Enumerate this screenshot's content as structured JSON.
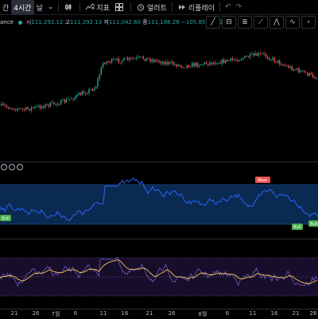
{
  "toolbar": {
    "items": [
      {
        "label": "간",
        "active": false
      },
      {
        "label": "4시간",
        "active": true
      },
      {
        "label": "날",
        "active": false
      }
    ],
    "indicators_label": "지표",
    "alert_label": "얼러트",
    "replay_label": "리플레이"
  },
  "symbol": {
    "name": "ance",
    "ohlc": {
      "open_label": "시",
      "open": "111,292.12",
      "high_label": "고",
      "high": "111,292.13",
      "low_label": "저",
      "low": "111,042.60",
      "close_label": "종",
      "close": "111,186.28",
      "change": "−105.85 (−0.10%)"
    }
  },
  "colors": {
    "up": "#26a69a",
    "down": "#ef5350",
    "osc_line": "#2962ff",
    "osc_band": "#0c2f5a",
    "rsi_line": "#7e57c2",
    "signal_line": "#f2c94c",
    "bull_tag": "#4caf50",
    "bear_tag": "#ef5350"
  },
  "tags": {
    "bear": "Bear",
    "bull": "Bull"
  },
  "x_axis": {
    "ticks": [
      "21",
      "26",
      "7월",
      "6",
      "11",
      "16",
      "21",
      "26",
      "8월",
      "6",
      "11",
      "16",
      "21",
      "26"
    ]
  }
}
